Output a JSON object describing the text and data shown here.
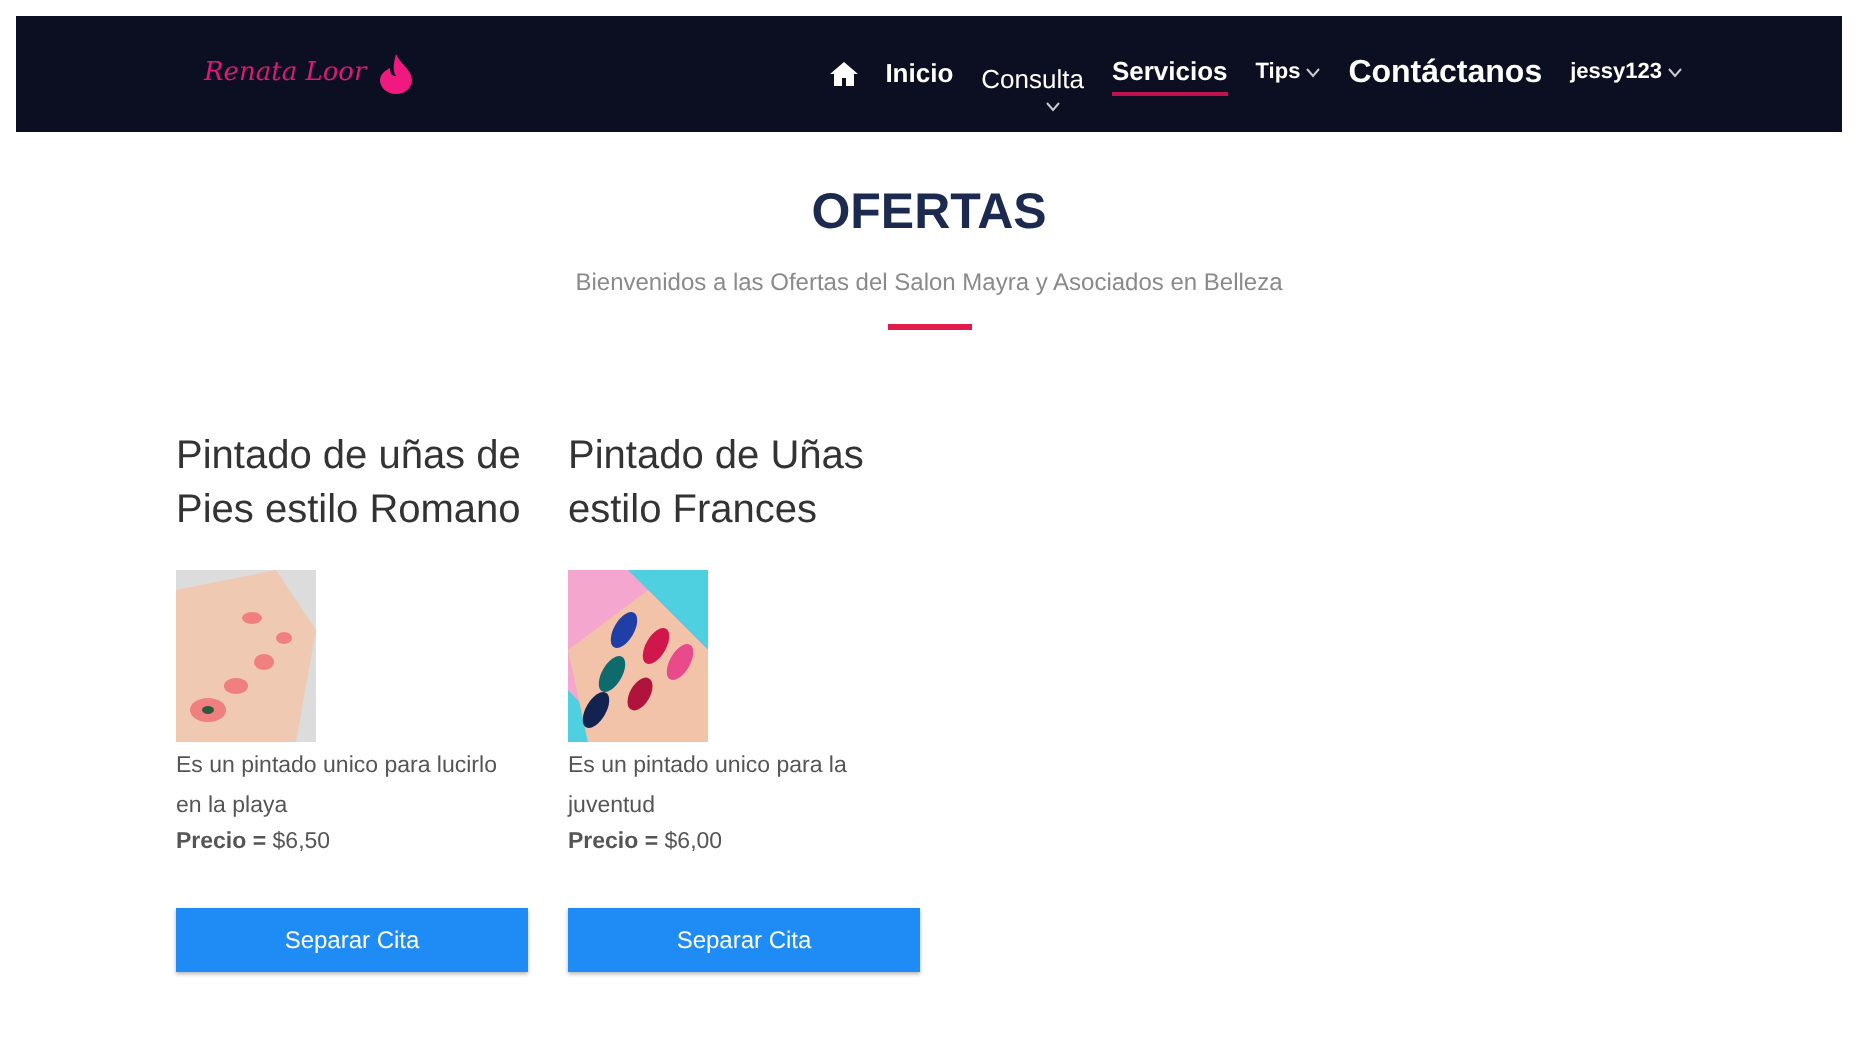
{
  "navbar": {
    "brand": "Renata Loor",
    "items": [
      {
        "label": "Inicio",
        "kind": "bold",
        "selected": false,
        "dropdown": false
      },
      {
        "label": "Consulta",
        "kind": "plain",
        "selected": false,
        "dropdown": true
      },
      {
        "label": "Servicios",
        "kind": "bold",
        "selected": true,
        "dropdown": false
      },
      {
        "label": "Tips",
        "kind": "small",
        "selected": false,
        "dropdown": true
      },
      {
        "label": "Contáctanos",
        "kind": "large",
        "selected": false,
        "dropdown": false
      },
      {
        "label": "jessy123",
        "kind": "small",
        "selected": false,
        "dropdown": true
      }
    ]
  },
  "header": {
    "title": "OFERTAS",
    "subtitle": "Bienvenidos a las Ofertas del Salon Mayra y Asociados en Belleza"
  },
  "offers": [
    {
      "title": "Pintado de uñas de Pies estilo Romano",
      "description": "Es un pintado unico para lucirlo en la playa",
      "price": "**Precio =** $6,50",
      "button": "Separar Cita"
    },
    {
      "title": "Pintado de Uñas estilo Frances",
      "description": "Es un pintado unico para la juventud",
      "price": "**Precio =** $6,00",
      "button": "Separar Cita"
    }
  ]
}
